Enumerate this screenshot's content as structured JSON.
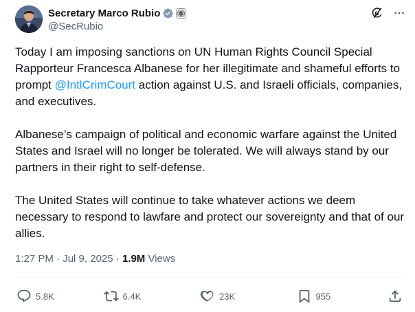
{
  "author": {
    "display_name": "Secretary Marco Rubio",
    "handle": "@SecRubio",
    "verified_color": "#829aab"
  },
  "header": {
    "icons": [
      "grok-icon",
      "more-icon"
    ]
  },
  "post": {
    "p1_before": "Today I am imposing sanctions on UN Human Rights Council Special Rapporteur Francesca Albanese for her illegitimate and shameful efforts to prompt ",
    "p1_mention": "@IntlCrimCourt",
    "p1_after": " action against U.S. and Israeli officials, companies, and executives.",
    "p2": "Albanese’s campaign of political and economic warfare against the United States and Israel will no longer be tolerated. We will always stand by our partners in their right to self-defense.",
    "p3": "The United States will continue to take whatever actions we deem necessary to respond to lawfare and protect our sovereignty and that of our allies."
  },
  "meta": {
    "time": "1:27 PM",
    "date": "Jul 9, 2025",
    "views_count": "1.9M",
    "views_label": "Views"
  },
  "actions": {
    "replies": "5.8K",
    "reposts": "6.4K",
    "likes": "23K",
    "bookmarks": "955"
  },
  "colors": {
    "accent": "#1d9bf0",
    "secondary_text": "#536471",
    "text": "#0f1419"
  }
}
